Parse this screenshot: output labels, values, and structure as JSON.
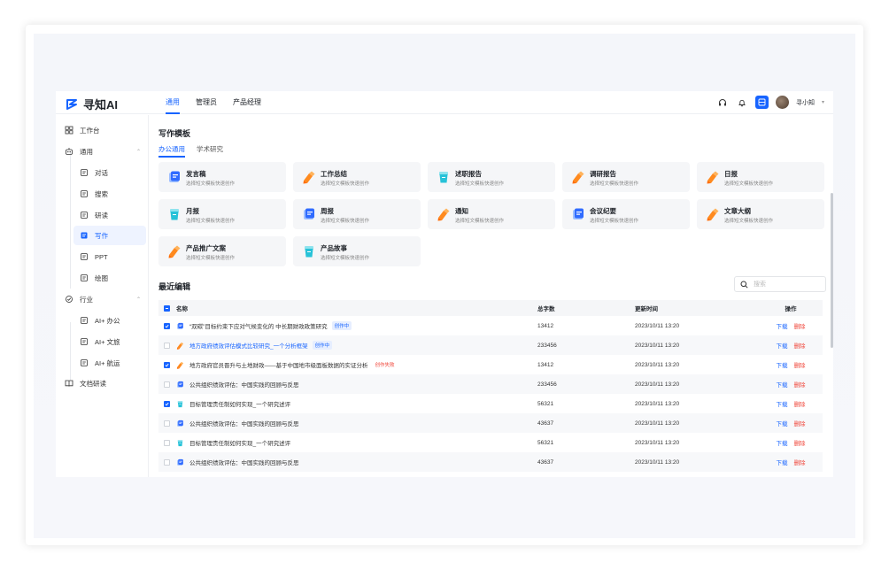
{
  "app": {
    "logo_text": "寻知AI"
  },
  "header": {
    "nav": [
      {
        "label": "通用",
        "active": true
      },
      {
        "label": "管理员",
        "active": false
      },
      {
        "label": "产品经理",
        "active": false
      }
    ],
    "user_name": "寻小知"
  },
  "sidebar": {
    "items": [
      {
        "label": "工作台",
        "icon": "grid-icon",
        "level": "top"
      },
      {
        "label": "通用",
        "icon": "robot-icon",
        "level": "top",
        "expanded": true
      },
      {
        "label": "对话",
        "icon": "chat-icon",
        "level": "sub"
      },
      {
        "label": "搜索",
        "icon": "search-icon",
        "level": "sub"
      },
      {
        "label": "研读",
        "icon": "read-icon",
        "level": "sub"
      },
      {
        "label": "写作",
        "icon": "write-icon",
        "level": "sub",
        "active": true
      },
      {
        "label": "PPT",
        "icon": "ppt-icon",
        "level": "sub"
      },
      {
        "label": "绘图",
        "icon": "image-icon",
        "level": "sub"
      },
      {
        "label": "行业",
        "icon": "industry-icon",
        "level": "top",
        "expanded": true
      },
      {
        "label": "AI+ 办公",
        "icon": "office-icon",
        "level": "sub"
      },
      {
        "label": "AI+ 文旅",
        "icon": "travel-icon",
        "level": "sub"
      },
      {
        "label": "AI+ 航运",
        "icon": "shipping-icon",
        "level": "sub"
      },
      {
        "label": "文档研读",
        "icon": "book-icon",
        "level": "top"
      }
    ]
  },
  "templates": {
    "title": "写作模板",
    "tabs": [
      {
        "label": "办公通用",
        "active": true
      },
      {
        "label": "学术研究",
        "active": false
      }
    ],
    "cards": [
      {
        "title": "发言稿",
        "desc": "选择短文模板快速创作",
        "icon": "blue-doc"
      },
      {
        "title": "工作总结",
        "desc": "选择短文模板快速创作",
        "icon": "orange-pen"
      },
      {
        "title": "述职报告",
        "desc": "选择短文模板快速创作",
        "icon": "cyan-cup"
      },
      {
        "title": "调研报告",
        "desc": "选择短文模板快速创作",
        "icon": "orange-pen"
      },
      {
        "title": "日报",
        "desc": "选择短文模板快速创作",
        "icon": "orange-pen"
      },
      {
        "title": "月报",
        "desc": "选择短文模板快速创作",
        "icon": "cyan-cup"
      },
      {
        "title": "周报",
        "desc": "选择短文模板快速创作",
        "icon": "blue-doc"
      },
      {
        "title": "通知",
        "desc": "选择短文模板快速创作",
        "icon": "orange-pen"
      },
      {
        "title": "会议纪要",
        "desc": "选择短文模板快速创作",
        "icon": "blue-doc"
      },
      {
        "title": "文章大纲",
        "desc": "选择短文模板快速创作",
        "icon": "orange-pen"
      },
      {
        "title": "产品推广文案",
        "desc": "选择短文模板快速创作",
        "icon": "orange-pen"
      },
      {
        "title": "产品故事",
        "desc": "选择短文模板快速创作",
        "icon": "cyan-cup"
      }
    ]
  },
  "recent": {
    "title": "最近编辑",
    "search_placeholder": "搜索",
    "columns": {
      "name": "名称",
      "count": "总字数",
      "time": "更新时间",
      "ops": "操作"
    },
    "op_download": "下载",
    "op_delete": "删除",
    "rows": [
      {
        "name": "“双碳”目标约束下应对气候变化的 中长期财政政策研究",
        "tag": "创作中",
        "tag_color": "blue",
        "count": "13412",
        "time": "2023/10/11 13:20",
        "checked": true,
        "icon": "blue-doc",
        "link": false
      },
      {
        "name": "地方政府绩效评估模式比较研究_一个分析框架",
        "tag": "创作中",
        "tag_color": "blue",
        "count": "233456",
        "time": "2023/10/11 13:20",
        "checked": false,
        "icon": "orange-pen",
        "link": true
      },
      {
        "name": "地方政府官员晋升与土地财政——基于中国地市级面板数据的实证分析",
        "tag": "创作失败",
        "tag_color": "red",
        "count": "13412",
        "time": "2023/10/11 13:20",
        "checked": true,
        "icon": "orange-pen",
        "link": false
      },
      {
        "name": "公共组织绩效评估：中国实践的回顾与反思",
        "tag": "",
        "tag_color": "",
        "count": "233456",
        "time": "2023/10/11 13:20",
        "checked": false,
        "icon": "blue-doc",
        "link": false
      },
      {
        "name": "目标管理责任制如何实现_一个研究述评",
        "tag": "",
        "tag_color": "",
        "count": "56321",
        "time": "2023/10/11 13:20",
        "checked": true,
        "icon": "cyan-cup",
        "link": false
      },
      {
        "name": "公共组织绩效评估：中国实践的回顾与反思",
        "tag": "",
        "tag_color": "",
        "count": "43637",
        "time": "2023/10/11 13:20",
        "checked": false,
        "icon": "blue-doc",
        "link": false
      },
      {
        "name": "目标管理责任制如何实现_一个研究述评",
        "tag": "",
        "tag_color": "",
        "count": "56321",
        "time": "2023/10/11 13:20",
        "checked": false,
        "icon": "cyan-cup",
        "link": false
      },
      {
        "name": "公共组织绩效评估：中国实践的回顾与反思",
        "tag": "",
        "tag_color": "",
        "count": "43637",
        "time": "2023/10/11 13:20",
        "checked": false,
        "icon": "blue-doc",
        "link": false
      }
    ]
  },
  "colors": {
    "accent": "#1764ff",
    "danger": "#f04438",
    "card_bg": "#f5f6f8"
  }
}
